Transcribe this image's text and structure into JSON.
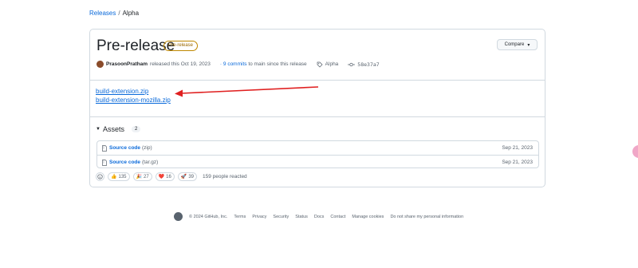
{
  "breadcrumb": {
    "root": "Releases",
    "separator": "/",
    "current": "Alpha"
  },
  "release": {
    "title": "Pre-release",
    "badge": "Pre-release",
    "compare_label": "Compare",
    "author": "PrasoonPratham",
    "released_text": "released this Oct 19, 2023",
    "commits_link": "· 9 commits",
    "commits_text": "to main since this release",
    "tag": "Alpha",
    "commit_hash": "58e37a7"
  },
  "links": [
    "build-extension.zip",
    "build-extension-mozilla.zip"
  ],
  "assets": {
    "label": "Assets",
    "count": "2",
    "rows": [
      {
        "name": "Source code",
        "ext": "(zip)",
        "date": "Sep 21, 2023"
      },
      {
        "name": "Source code",
        "ext": "(tar.gz)",
        "date": "Sep 21, 2023"
      }
    ]
  },
  "reactions": {
    "items": [
      {
        "emoji": "👍",
        "count": "135"
      },
      {
        "emoji": "🎉",
        "count": "27"
      },
      {
        "emoji": "❤️",
        "count": "16"
      },
      {
        "emoji": "🚀",
        "count": "39"
      }
    ],
    "summary": "159 people reacted"
  },
  "footer": {
    "copyright": "© 2024 GitHub, Inc.",
    "links": [
      "Terms",
      "Privacy",
      "Security",
      "Status",
      "Docs",
      "Contact",
      "Manage cookies",
      "Do not share my personal information"
    ]
  },
  "colors": {
    "accent": "#0969da",
    "arrow": "#e02020",
    "badge": "#9a6700"
  },
  "icons": [
    "tag-icon",
    "commit-icon",
    "file-zip-icon",
    "smiley-icon",
    "github-logo-icon"
  ]
}
